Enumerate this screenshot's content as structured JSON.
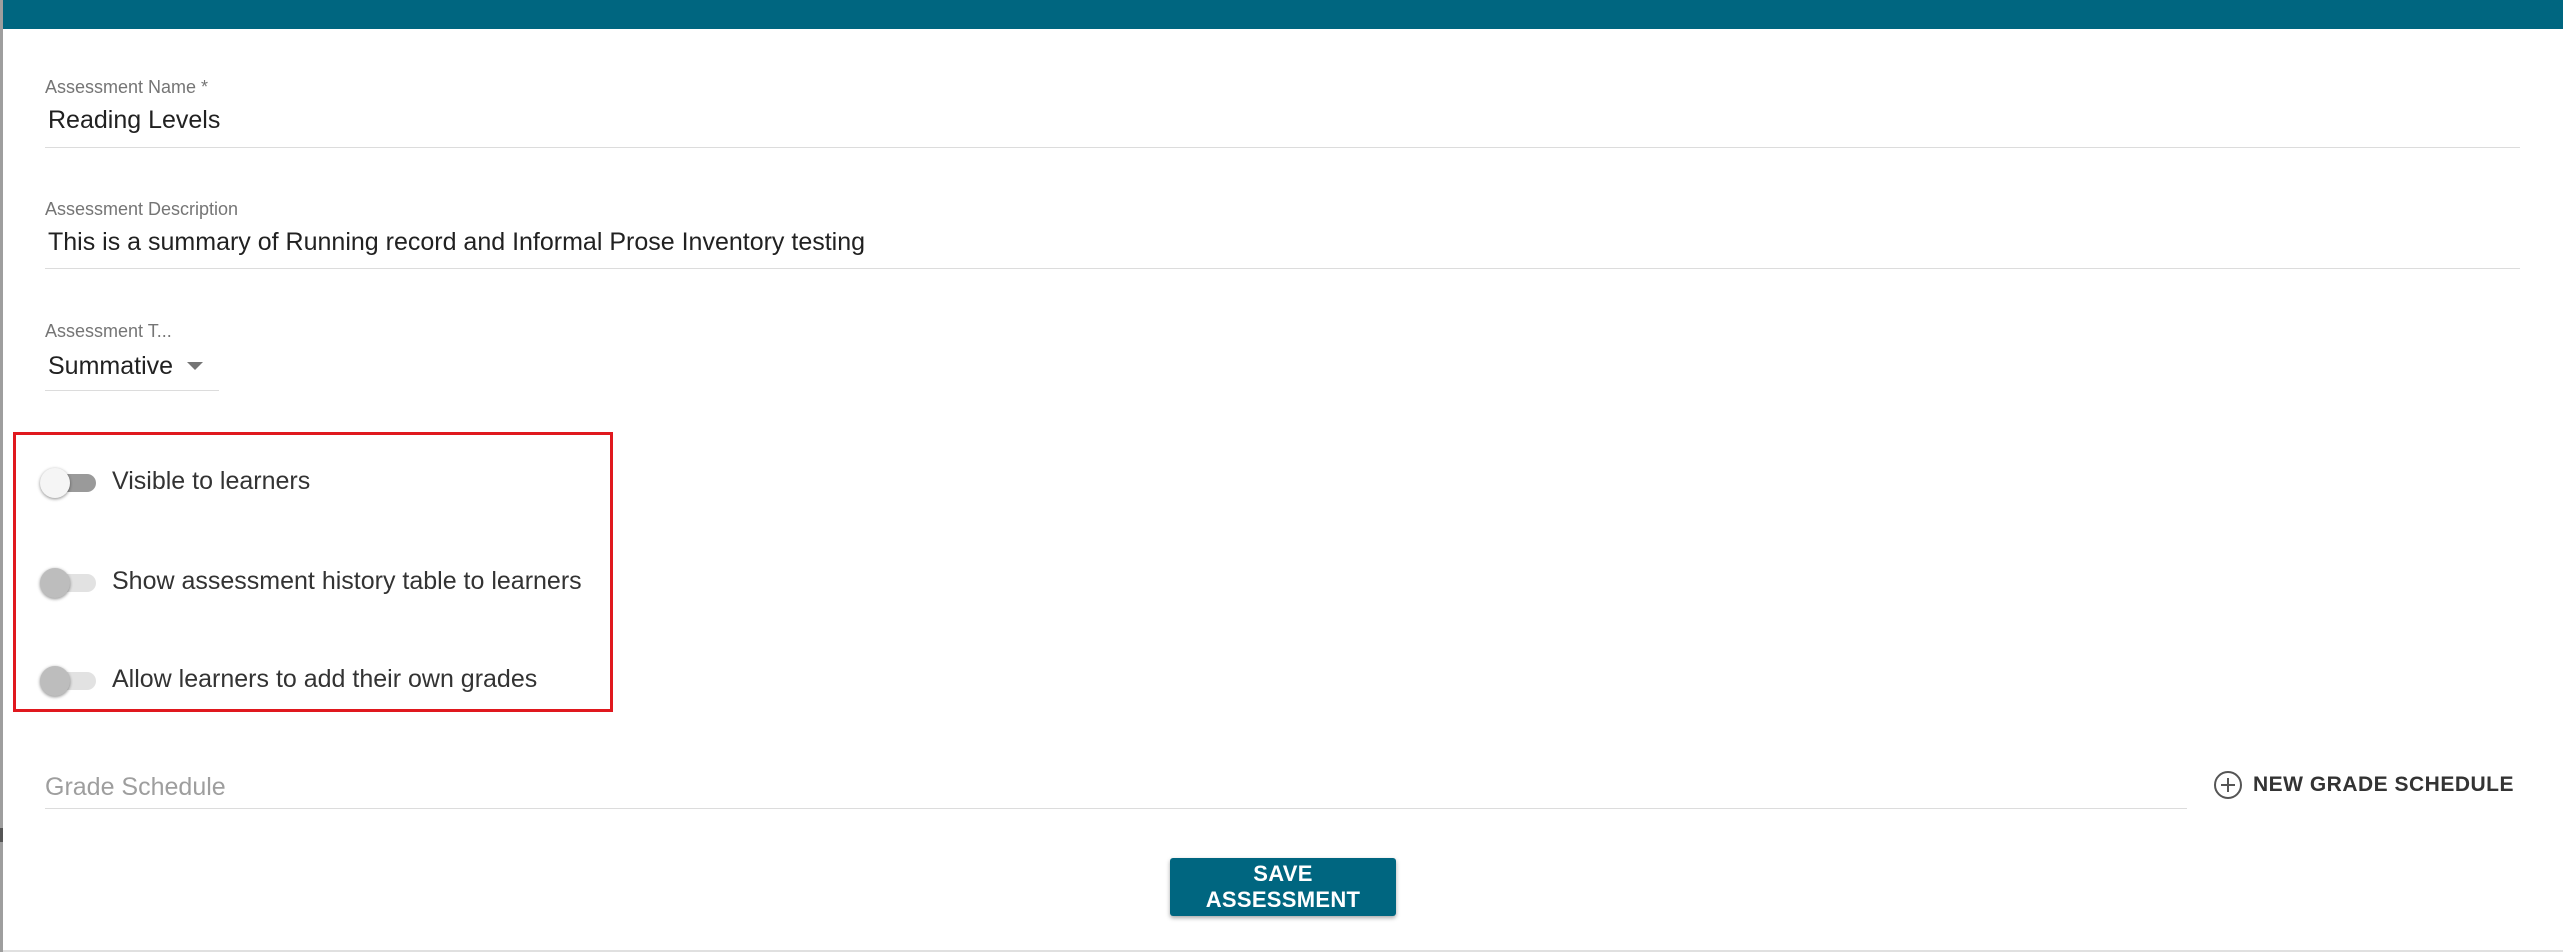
{
  "colors": {
    "primary": "#006680",
    "highlight": "#e0181e",
    "switch_track_on": "#9a9a9a",
    "switch_track_off": "#e2e2e2",
    "switch_thumb_on": "#f5f5f5",
    "switch_thumb_off": "#bdbdbd"
  },
  "form": {
    "name": {
      "label": "Assessment Name *",
      "value": "Reading Levels"
    },
    "description": {
      "label": "Assessment Description",
      "value": "This is a summary of Running record and Informal Prose Inventory testing"
    },
    "type": {
      "label": "Assessment T...",
      "value": "Summative",
      "icon": "chevron-down-icon"
    },
    "toggles": [
      {
        "label": "Visible to learners",
        "checked": true
      },
      {
        "label": "Show assessment history table to learners",
        "checked": false
      },
      {
        "label": "Allow learners to add their own grades",
        "checked": false
      }
    ],
    "grade_schedule": {
      "placeholder": "Grade Schedule",
      "new_button_label": "NEW GRADE SCHEDULE",
      "new_button_icon": "plus-circle-icon"
    },
    "save_label": "SAVE ASSESSMENT"
  }
}
